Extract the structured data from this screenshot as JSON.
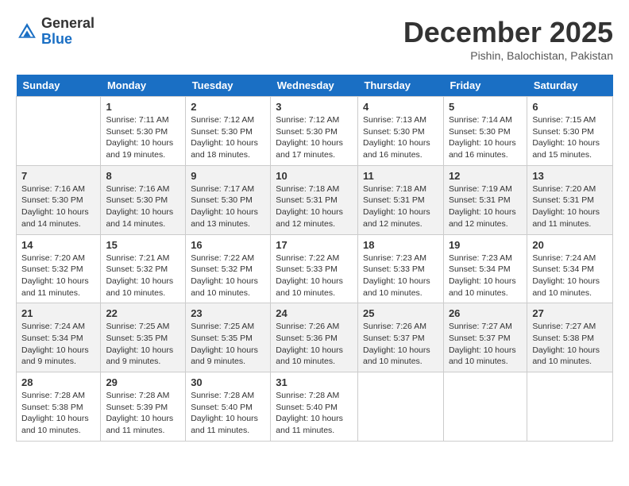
{
  "header": {
    "logo_general": "General",
    "logo_blue": "Blue",
    "month_title": "December 2025",
    "location": "Pishin, Balochistan, Pakistan"
  },
  "weekdays": [
    "Sunday",
    "Monday",
    "Tuesday",
    "Wednesday",
    "Thursday",
    "Friday",
    "Saturday"
  ],
  "weeks": [
    [
      {
        "day": "",
        "sunrise": "",
        "sunset": "",
        "daylight": ""
      },
      {
        "day": "1",
        "sunrise": "Sunrise: 7:11 AM",
        "sunset": "Sunset: 5:30 PM",
        "daylight": "Daylight: 10 hours and 19 minutes."
      },
      {
        "day": "2",
        "sunrise": "Sunrise: 7:12 AM",
        "sunset": "Sunset: 5:30 PM",
        "daylight": "Daylight: 10 hours and 18 minutes."
      },
      {
        "day": "3",
        "sunrise": "Sunrise: 7:12 AM",
        "sunset": "Sunset: 5:30 PM",
        "daylight": "Daylight: 10 hours and 17 minutes."
      },
      {
        "day": "4",
        "sunrise": "Sunrise: 7:13 AM",
        "sunset": "Sunset: 5:30 PM",
        "daylight": "Daylight: 10 hours and 16 minutes."
      },
      {
        "day": "5",
        "sunrise": "Sunrise: 7:14 AM",
        "sunset": "Sunset: 5:30 PM",
        "daylight": "Daylight: 10 hours and 16 minutes."
      },
      {
        "day": "6",
        "sunrise": "Sunrise: 7:15 AM",
        "sunset": "Sunset: 5:30 PM",
        "daylight": "Daylight: 10 hours and 15 minutes."
      }
    ],
    [
      {
        "day": "7",
        "sunrise": "Sunrise: 7:16 AM",
        "sunset": "Sunset: 5:30 PM",
        "daylight": "Daylight: 10 hours and 14 minutes."
      },
      {
        "day": "8",
        "sunrise": "Sunrise: 7:16 AM",
        "sunset": "Sunset: 5:30 PM",
        "daylight": "Daylight: 10 hours and 14 minutes."
      },
      {
        "day": "9",
        "sunrise": "Sunrise: 7:17 AM",
        "sunset": "Sunset: 5:30 PM",
        "daylight": "Daylight: 10 hours and 13 minutes."
      },
      {
        "day": "10",
        "sunrise": "Sunrise: 7:18 AM",
        "sunset": "Sunset: 5:31 PM",
        "daylight": "Daylight: 10 hours and 12 minutes."
      },
      {
        "day": "11",
        "sunrise": "Sunrise: 7:18 AM",
        "sunset": "Sunset: 5:31 PM",
        "daylight": "Daylight: 10 hours and 12 minutes."
      },
      {
        "day": "12",
        "sunrise": "Sunrise: 7:19 AM",
        "sunset": "Sunset: 5:31 PM",
        "daylight": "Daylight: 10 hours and 12 minutes."
      },
      {
        "day": "13",
        "sunrise": "Sunrise: 7:20 AM",
        "sunset": "Sunset: 5:31 PM",
        "daylight": "Daylight: 10 hours and 11 minutes."
      }
    ],
    [
      {
        "day": "14",
        "sunrise": "Sunrise: 7:20 AM",
        "sunset": "Sunset: 5:32 PM",
        "daylight": "Daylight: 10 hours and 11 minutes."
      },
      {
        "day": "15",
        "sunrise": "Sunrise: 7:21 AM",
        "sunset": "Sunset: 5:32 PM",
        "daylight": "Daylight: 10 hours and 10 minutes."
      },
      {
        "day": "16",
        "sunrise": "Sunrise: 7:22 AM",
        "sunset": "Sunset: 5:32 PM",
        "daylight": "Daylight: 10 hours and 10 minutes."
      },
      {
        "day": "17",
        "sunrise": "Sunrise: 7:22 AM",
        "sunset": "Sunset: 5:33 PM",
        "daylight": "Daylight: 10 hours and 10 minutes."
      },
      {
        "day": "18",
        "sunrise": "Sunrise: 7:23 AM",
        "sunset": "Sunset: 5:33 PM",
        "daylight": "Daylight: 10 hours and 10 minutes."
      },
      {
        "day": "19",
        "sunrise": "Sunrise: 7:23 AM",
        "sunset": "Sunset: 5:34 PM",
        "daylight": "Daylight: 10 hours and 10 minutes."
      },
      {
        "day": "20",
        "sunrise": "Sunrise: 7:24 AM",
        "sunset": "Sunset: 5:34 PM",
        "daylight": "Daylight: 10 hours and 10 minutes."
      }
    ],
    [
      {
        "day": "21",
        "sunrise": "Sunrise: 7:24 AM",
        "sunset": "Sunset: 5:34 PM",
        "daylight": "Daylight: 10 hours and 9 minutes."
      },
      {
        "day": "22",
        "sunrise": "Sunrise: 7:25 AM",
        "sunset": "Sunset: 5:35 PM",
        "daylight": "Daylight: 10 hours and 9 minutes."
      },
      {
        "day": "23",
        "sunrise": "Sunrise: 7:25 AM",
        "sunset": "Sunset: 5:35 PM",
        "daylight": "Daylight: 10 hours and 9 minutes."
      },
      {
        "day": "24",
        "sunrise": "Sunrise: 7:26 AM",
        "sunset": "Sunset: 5:36 PM",
        "daylight": "Daylight: 10 hours and 10 minutes."
      },
      {
        "day": "25",
        "sunrise": "Sunrise: 7:26 AM",
        "sunset": "Sunset: 5:37 PM",
        "daylight": "Daylight: 10 hours and 10 minutes."
      },
      {
        "day": "26",
        "sunrise": "Sunrise: 7:27 AM",
        "sunset": "Sunset: 5:37 PM",
        "daylight": "Daylight: 10 hours and 10 minutes."
      },
      {
        "day": "27",
        "sunrise": "Sunrise: 7:27 AM",
        "sunset": "Sunset: 5:38 PM",
        "daylight": "Daylight: 10 hours and 10 minutes."
      }
    ],
    [
      {
        "day": "28",
        "sunrise": "Sunrise: 7:28 AM",
        "sunset": "Sunset: 5:38 PM",
        "daylight": "Daylight: 10 hours and 10 minutes."
      },
      {
        "day": "29",
        "sunrise": "Sunrise: 7:28 AM",
        "sunset": "Sunset: 5:39 PM",
        "daylight": "Daylight: 10 hours and 11 minutes."
      },
      {
        "day": "30",
        "sunrise": "Sunrise: 7:28 AM",
        "sunset": "Sunset: 5:40 PM",
        "daylight": "Daylight: 10 hours and 11 minutes."
      },
      {
        "day": "31",
        "sunrise": "Sunrise: 7:28 AM",
        "sunset": "Sunset: 5:40 PM",
        "daylight": "Daylight: 10 hours and 11 minutes."
      },
      {
        "day": "",
        "sunrise": "",
        "sunset": "",
        "daylight": ""
      },
      {
        "day": "",
        "sunrise": "",
        "sunset": "",
        "daylight": ""
      },
      {
        "day": "",
        "sunrise": "",
        "sunset": "",
        "daylight": ""
      }
    ]
  ]
}
